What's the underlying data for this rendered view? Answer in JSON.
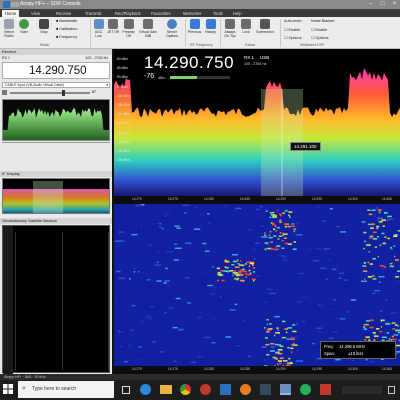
{
  "window": {
    "title": "Airspy HF+ – SDR Console"
  },
  "tabs": [
    "Home",
    "View",
    "Receive",
    "Transmit",
    "Rec/Playback",
    "Favourites",
    "Memories",
    "Tools",
    "Help"
  ],
  "ribbon": {
    "select_radio": "Select Radio",
    "start": "Start",
    "stop": "Stop",
    "bandwidth": "Bandwidth",
    "calibration": "Calibration",
    "frequency": "Frequency",
    "radio_group": "Radio",
    "agc": "AGC Low",
    "jet": "JET Off",
    "preamp": "Preamp Off",
    "virtual_gain": "Virtual Gain 0dB",
    "server_options": "Server Options",
    "previous": "Previous",
    "history": "History",
    "always_on_top": "Always On Top",
    "lock": "Lock",
    "screenshot": "Screenshot",
    "rf_group": "RF Frequency",
    "extras_group": "Extras",
    "auto_mute": "Auto-mute",
    "auto_enable": "Enable",
    "auto_options": "Options",
    "noise_blanker": "Noise Blanker",
    "nb_enable": "Enable",
    "nb_options": "Options",
    "wideband_group": "Wideband DSP"
  },
  "receive_panel": {
    "header": "Receive",
    "rx_label": "RX 1",
    "range": "100 - 2700 Hz",
    "frequency": "14.290.750",
    "audio_device": "CABLE Input (VB-Audio Virtual Cable)",
    "volume": "87"
  },
  "if_display": {
    "header": "IF Display"
  },
  "beacon": {
    "header": "Geostationary Satellite Beacon"
  },
  "main_display": {
    "frequency": "14.290.750",
    "rx": "RX 1",
    "mode": "USB",
    "bw": "100 - 2700 Hz",
    "signal": "-76",
    "signal_unit": "dBm",
    "cursor_freq": "14.291.100",
    "db_ticks": [
      "-80 dBm",
      "-85 dBm",
      "-90 dBm",
      "-95 dBm",
      "-100 dBm",
      "-105 dBm",
      "-110 dBm",
      "-115 dBm",
      "-120 dBm",
      "-125 dBm",
      "-130 dBm",
      "-135 dBm"
    ],
    "freq_ticks": [
      "14.270",
      "14.275",
      "14.280",
      "14.285",
      "14.290",
      "14.295",
      "14.300",
      "14.305"
    ]
  },
  "waterfall": {
    "freq_label": "Freq:",
    "freq_value": "14.296.5 MHz",
    "span_label": "Span:",
    "span_value": "±15 kHz",
    "freq_ticks": [
      "14.270",
      "14.275",
      "14.280",
      "14.285",
      "14.290",
      "14.295",
      "14.300",
      "14.305"
    ]
  },
  "status": {
    "text": "Airspy HF+ · 8kS · 30 kHz"
  },
  "taskbar": {
    "search_placeholder": "Type here to search"
  }
}
